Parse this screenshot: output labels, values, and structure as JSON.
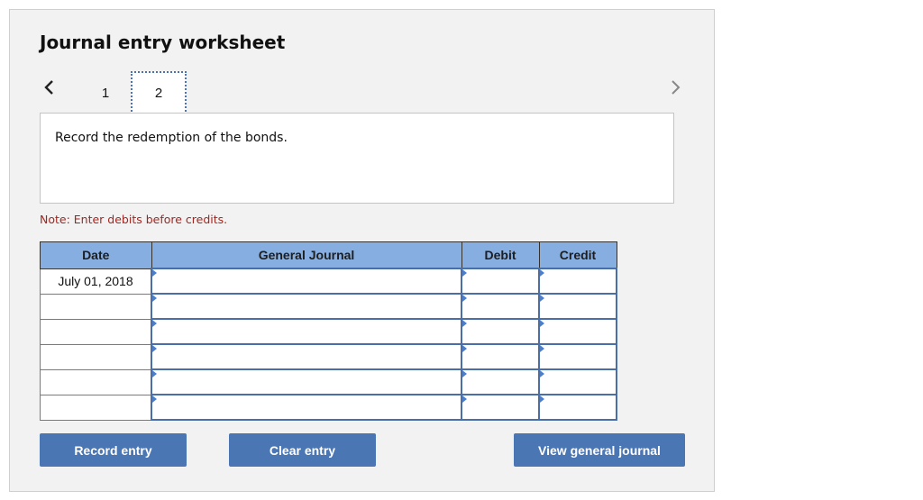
{
  "title": "Journal entry worksheet",
  "nav": {
    "prev_icon": "chevron-left-icon",
    "next_icon": "chevron-right-icon",
    "steps": [
      "1",
      "2"
    ],
    "active_step": "2"
  },
  "instruction": "Record the redemption of the bonds.",
  "note": "Note: Enter debits before credits.",
  "table": {
    "headers": {
      "date": "Date",
      "general_journal": "General Journal",
      "debit": "Debit",
      "credit": "Credit"
    },
    "rows": [
      {
        "date": "July 01, 2018",
        "account": "",
        "debit": "",
        "credit": ""
      },
      {
        "date": "",
        "account": "",
        "debit": "",
        "credit": ""
      },
      {
        "date": "",
        "account": "",
        "debit": "",
        "credit": ""
      },
      {
        "date": "",
        "account": "",
        "debit": "",
        "credit": ""
      },
      {
        "date": "",
        "account": "",
        "debit": "",
        "credit": ""
      },
      {
        "date": "",
        "account": "",
        "debit": "",
        "credit": ""
      }
    ]
  },
  "buttons": {
    "record": "Record entry",
    "clear": "Clear entry",
    "view": "View general journal"
  },
  "colors": {
    "accent": "#4a76b4",
    "header_bg": "#86aee0",
    "note": "#a4251f"
  }
}
